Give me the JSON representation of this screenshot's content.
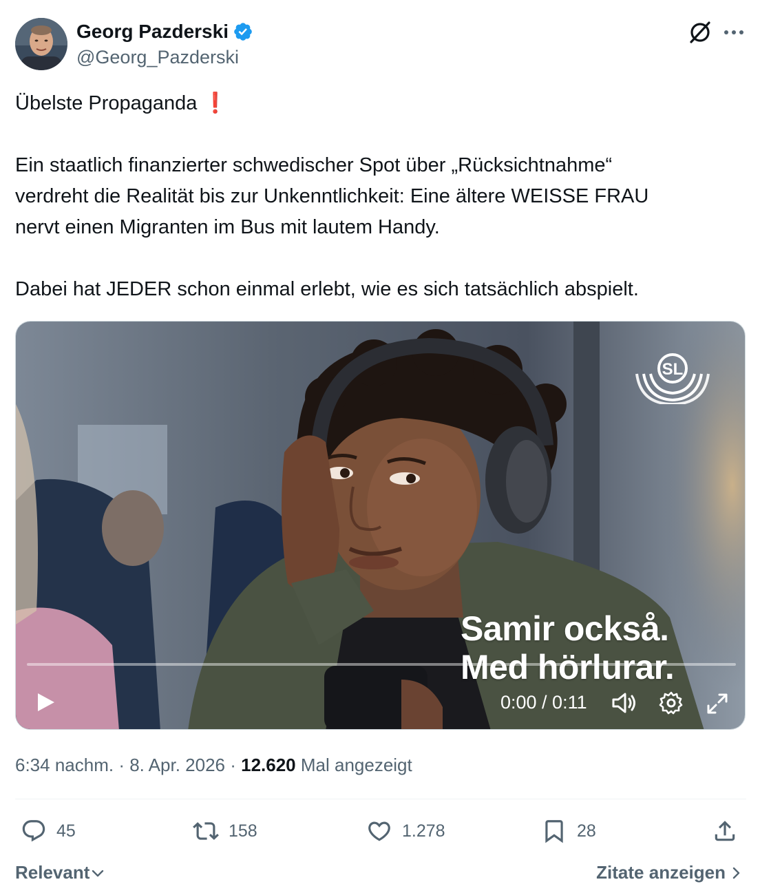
{
  "author": {
    "name": "Georg Pazderski",
    "handle": "@Georg_Pazderski",
    "verified_color": "#1d9bf0"
  },
  "post": {
    "line1": "Übelste Propaganda",
    "line1_emoji": "❗",
    "paragraph2_line1": "Ein staatlich finanzierter schwedischer Spot über „Rücksichtnahme“",
    "paragraph2_line2": "verdreht die Realität bis zur Unkenntlichkeit: Eine ältere WEISSE FRAU",
    "paragraph2_line3": "nervt einen Migranten im Bus mit lautem Handy.",
    "paragraph3": "Dabei hat JEDER schon einmal erlebt, wie es sich tatsächlich abspielt."
  },
  "video": {
    "logo_text": "SL",
    "subtitle_line1": "Samir också.",
    "subtitle_line2": "Med hörlurar.",
    "time": "0:00 / 0:11",
    "progress_fraction": 0
  },
  "meta": {
    "time": "6:34 nachm.",
    "separator1": " · ",
    "date": "8. Apr. 2026",
    "separator2": " · ",
    "views_count": "12.620",
    "views_label": " Mal angezeigt"
  },
  "actions": {
    "replies": "45",
    "reposts": "158",
    "likes": "1.278",
    "bookmarks": "28"
  },
  "footer": {
    "sort_label": "Relevant",
    "quotes_label": "Zitate anzeigen"
  },
  "colors": {
    "text_primary": "#0f1419",
    "text_secondary": "#536471",
    "accent": "#1d9bf0",
    "emoji_red": "#dd2e44"
  },
  "icons": [
    "verified-badge-icon",
    "grok-icon",
    "more-icon",
    "sl-logo",
    "play-icon",
    "volume-icon",
    "gear-icon",
    "expand-icon",
    "reply-icon",
    "repost-icon",
    "like-icon",
    "bookmark-icon",
    "share-icon",
    "chevron-down-icon",
    "chevron-right-icon"
  ]
}
